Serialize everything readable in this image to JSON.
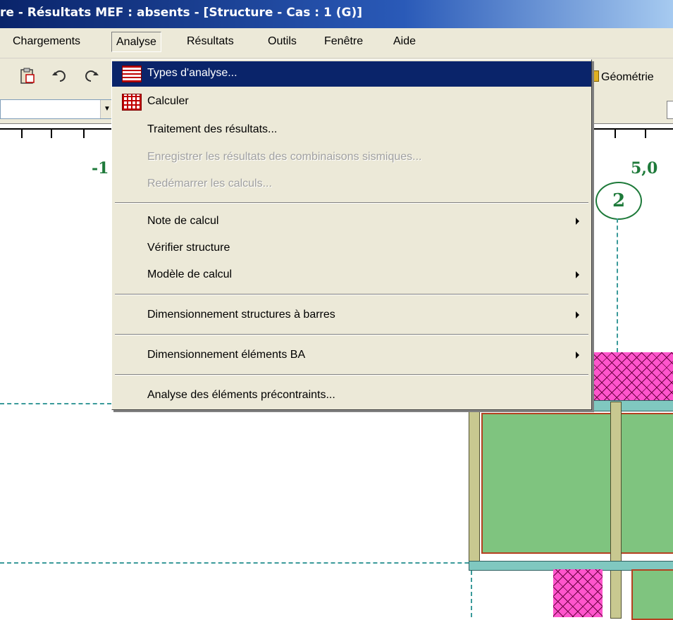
{
  "window": {
    "title": "re - Résultats MEF : absents - [Structure - Cas : 1 (G)]"
  },
  "menubar": {
    "items": [
      "Chargements",
      "Analyse",
      "Résultats",
      "Outils",
      "Fenêtre",
      "Aide"
    ]
  },
  "toolbar": {
    "icons": [
      "clipboard-icon",
      "undo-icon",
      "redo-icon"
    ],
    "view_label": "Géométrie"
  },
  "canvas": {
    "axis_labels": [
      "-1",
      "5,0"
    ],
    "grid_marker": "2"
  },
  "menu": {
    "items": [
      {
        "label": "Types d'analyse...",
        "underline": "T",
        "state": "highlighted",
        "icon": "analysis-types-icon"
      },
      {
        "label": "Calculer",
        "underline": "C",
        "state": "enabled",
        "icon": "calculate-icon"
      },
      {
        "label": "Traitement des résultats...",
        "state": "enabled"
      },
      {
        "label": "Enregistrer les résultats des combinaisons sismiques...",
        "state": "disabled"
      },
      {
        "label": "Redémarrer les calculs...",
        "underline": "R",
        "state": "disabled"
      },
      {
        "label": "Note de calcul",
        "underline": "t",
        "state": "enabled",
        "submenu": true
      },
      {
        "label": "Vérifier structure",
        "underline": "V",
        "state": "enabled"
      },
      {
        "label": "Modèle de calcul",
        "underline": "M",
        "state": "enabled",
        "submenu": true
      },
      {
        "label": "Dimensionnement structures à barres",
        "underline": "s",
        "state": "enabled",
        "submenu": true
      },
      {
        "label": "Dimensionnement éléments BA",
        "underline": "m",
        "state": "enabled",
        "submenu": true
      },
      {
        "label": "Analyse des éléments précontraints...",
        "underline": "p",
        "state": "enabled"
      }
    ]
  },
  "colors": {
    "menu_highlight": "#0a246a",
    "menu_background": "#ece9d8",
    "axis_green": "#1e7a3a",
    "mesh_pink": "#ff55cc",
    "slab_green": "#7fc47f"
  }
}
